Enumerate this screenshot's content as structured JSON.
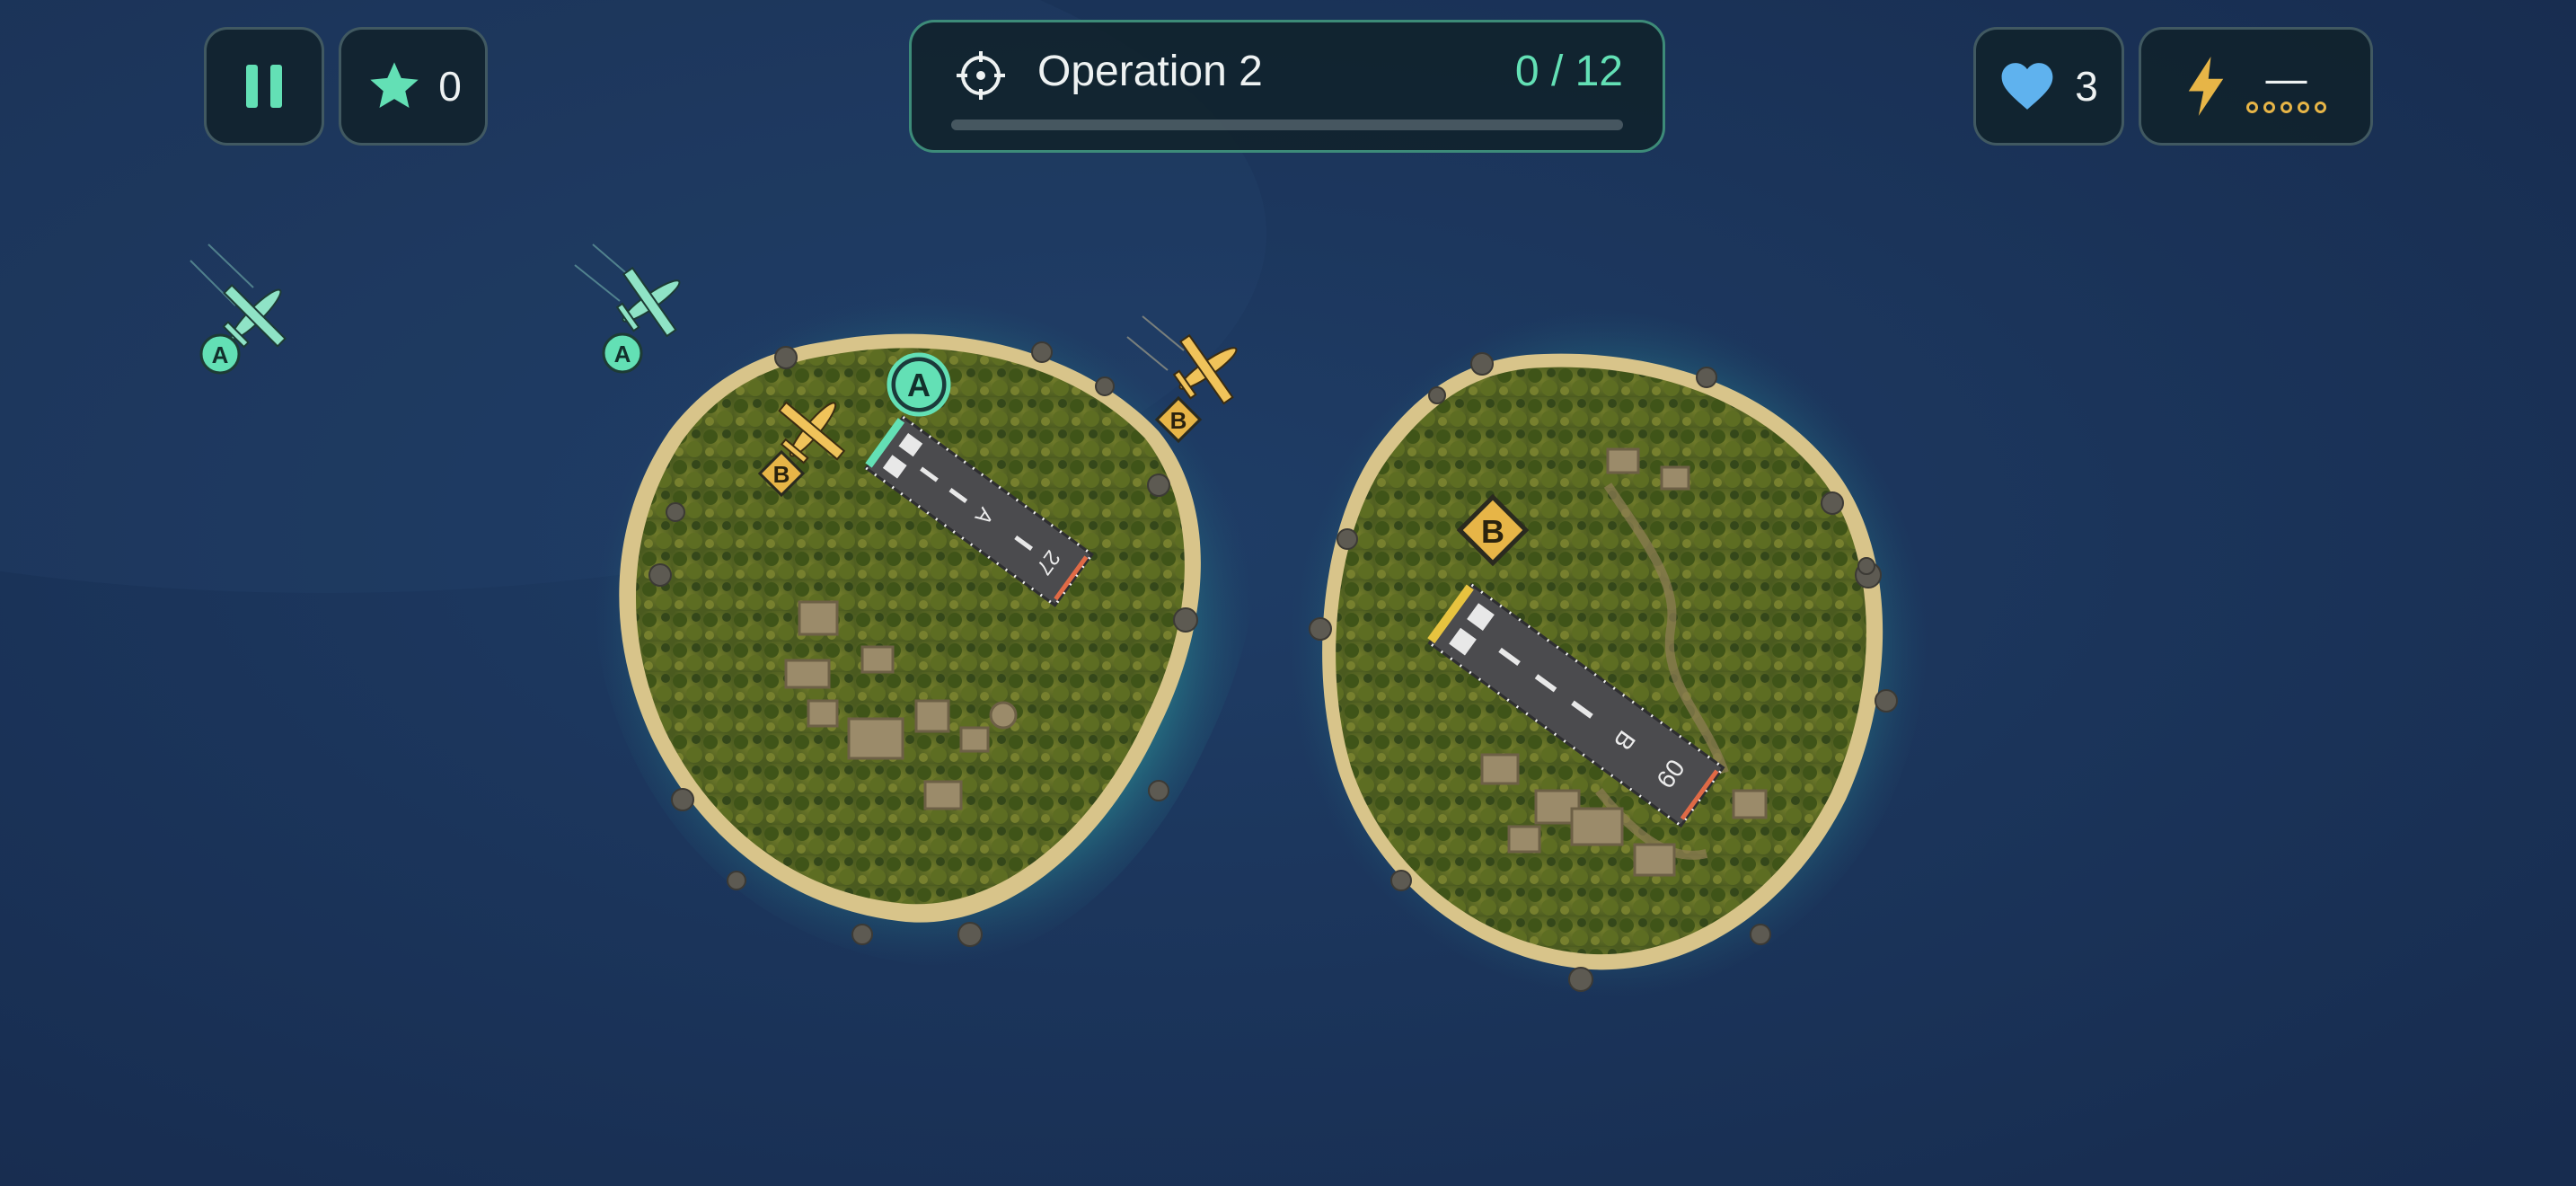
{
  "hud": {
    "stars": "0",
    "lives": "3",
    "power_value": "—",
    "power_slots": 5,
    "power_filled": 0
  },
  "mission": {
    "title": "Operation 2",
    "progress_text": "0 / 12",
    "progress": 0
  },
  "runways": [
    {
      "letter": "A",
      "end_number": "27",
      "color": "#63e0b5"
    },
    {
      "letter": "B",
      "end_number": "09",
      "color": "#e7c33f"
    }
  ],
  "aircraft": [
    {
      "label": "A",
      "color": "#63e0b5"
    },
    {
      "label": "A",
      "color": "#63e0b5"
    },
    {
      "label": "B",
      "color": "#e7b547"
    },
    {
      "label": "B",
      "color": "#e7b547"
    }
  ],
  "colors": {
    "sea": "#1a3358",
    "accent_green": "#63e0b5",
    "accent_yellow": "#e7b547",
    "heart": "#5fb2ee",
    "hud_bg": "#10222a"
  }
}
